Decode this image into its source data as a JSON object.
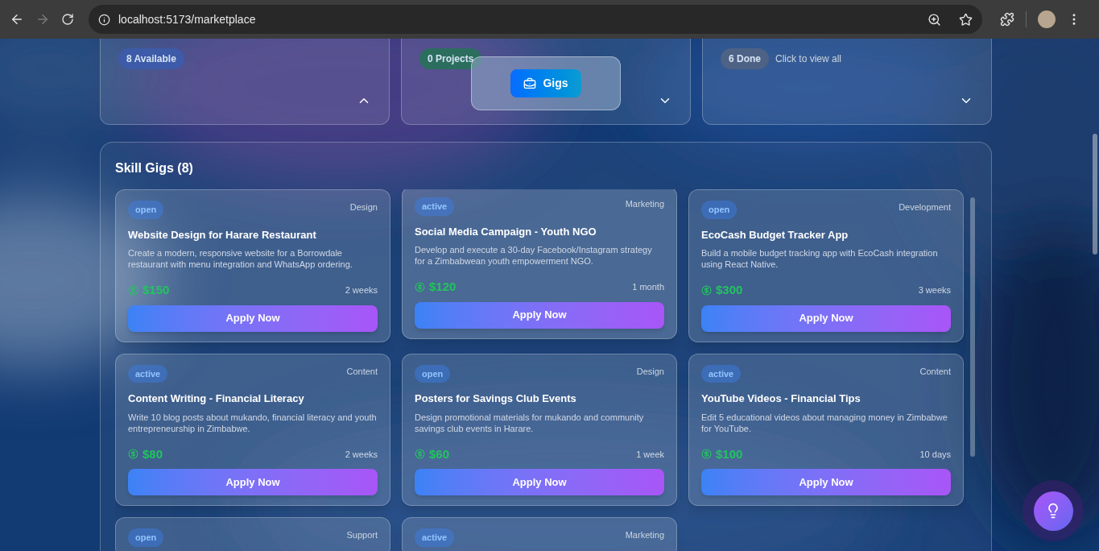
{
  "browser": {
    "url": "localhost:5173/marketplace",
    "forward_disabled": true
  },
  "stats": [
    {
      "badge": "8 Available",
      "color": "#3d5ba8",
      "expanded": true
    },
    {
      "badge": "0 Projects",
      "color": "#2b6e5e",
      "expanded": false
    },
    {
      "badge": "6 Done",
      "color": "#4d6285",
      "note": "Click to view all",
      "expanded": false
    }
  ],
  "floating_tab": {
    "label": "Gigs"
  },
  "gigs_panel": {
    "title": "Skill Gigs (8)",
    "gigs": [
      {
        "status": "open",
        "category": "Design",
        "title": "Website Design for Harare Restaurant",
        "description": "Create a modern, responsive website for a Borrowdale restaurant with menu integration and WhatsApp ordering.",
        "price": "$150",
        "duration": "2 weeks",
        "button": "Apply Now",
        "hovered": false
      },
      {
        "status": "active",
        "category": "Marketing",
        "title": "Social Media Campaign - Youth NGO",
        "description": "Develop and execute a 30-day Facebook/Instagram strategy for a Zimbabwean youth empowerment NGO.",
        "price": "$120",
        "duration": "1 month",
        "button": "Apply Now",
        "hovered": true
      },
      {
        "status": "open",
        "category": "Development",
        "title": "EcoCash Budget Tracker App",
        "description": "Build a mobile budget tracking app with EcoCash integration using React Native.",
        "price": "$300",
        "duration": "3 weeks",
        "button": "Apply Now",
        "hovered": false
      },
      {
        "status": "active",
        "category": "Content",
        "title": "Content Writing - Financial Literacy",
        "description": "Write 10 blog posts about mukando, financial literacy and youth entrepreneurship in Zimbabwe.",
        "price": "$80",
        "duration": "2 weeks",
        "button": "Apply Now",
        "hovered": false
      },
      {
        "status": "open",
        "category": "Design",
        "title": "Posters for Savings Club Events",
        "description": "Design promotional materials for mukando and community savings club events in Harare.",
        "price": "$60",
        "duration": "1 week",
        "button": "Apply Now",
        "hovered": false
      },
      {
        "status": "active",
        "category": "Content",
        "title": "YouTube Videos - Financial Tips",
        "description": "Edit 5 educational videos about managing money in Zimbabwe for YouTube.",
        "price": "$100",
        "duration": "10 days",
        "button": "Apply Now",
        "hovered": false
      },
      {
        "status": "open",
        "category": "Support",
        "hovered": false
      },
      {
        "status": "active",
        "category": "Marketing",
        "hovered": false
      }
    ]
  }
}
